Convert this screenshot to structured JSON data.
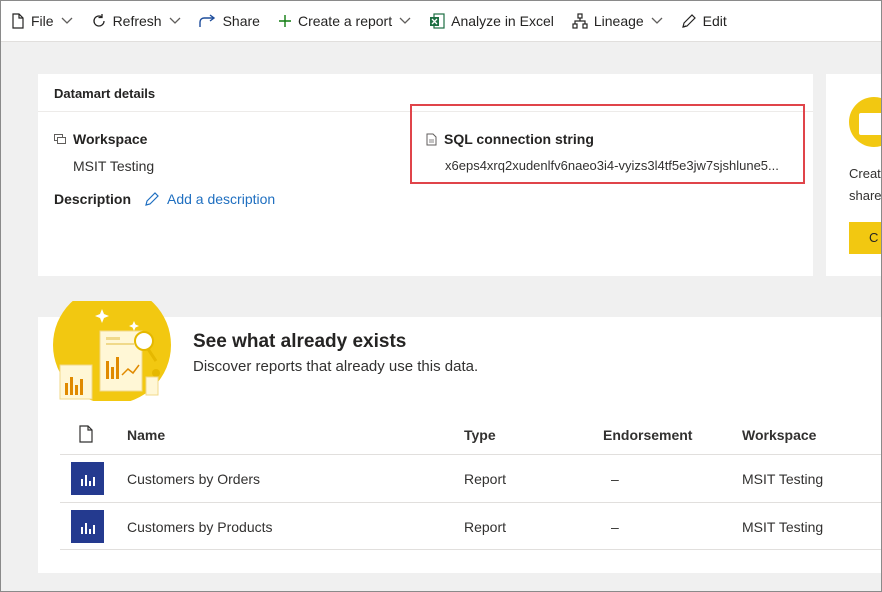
{
  "toolbar": {
    "file": "File",
    "refresh": "Refresh",
    "share": "Share",
    "create_report": "Create a report",
    "analyze_excel": "Analyze in Excel",
    "lineage": "Lineage",
    "edit": "Edit"
  },
  "details": {
    "title": "Datamart details",
    "workspace_label": "Workspace",
    "workspace_value": "MSIT Testing",
    "description_label": "Description",
    "add_description": "Add a description",
    "sql_label": "SQL connection string",
    "sql_value": "x6eps4xrq2xudenlfv6naeo3i4-vyizs3l4tf5e3jw7sjshlune5..."
  },
  "create_panel": {
    "text_line1": "Creat",
    "text_line2": "share",
    "button_label": "C"
  },
  "exists_section": {
    "title": "See what already exists",
    "subtitle": "Discover reports that already use this data.",
    "columns": [
      "Name",
      "Type",
      "Endorsement",
      "Workspace"
    ],
    "rows": [
      {
        "name": "Customers by Orders",
        "type": "Report",
        "endorsement": "–",
        "workspace": "MSIT Testing"
      },
      {
        "name": "Customers by Products",
        "type": "Report",
        "endorsement": "–",
        "workspace": "MSIT Testing"
      }
    ]
  },
  "colors": {
    "accent_yellow": "#f2c811",
    "link_blue": "#1f6fc0",
    "highlight_red": "#e0444a",
    "report_icon_blue": "#243a8f",
    "excel_green": "#1d6f42"
  }
}
